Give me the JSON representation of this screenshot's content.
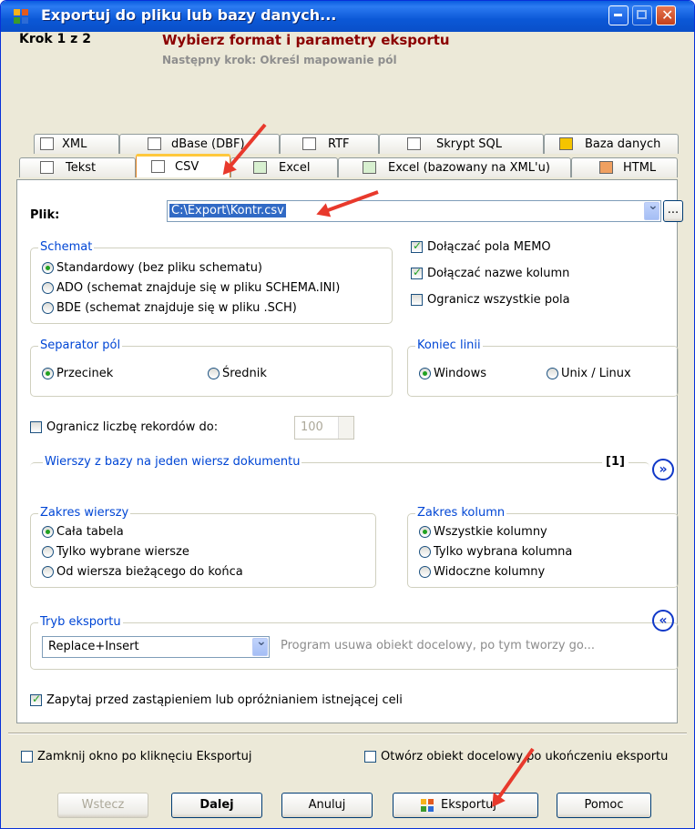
{
  "window": {
    "title": "Exportuj do pliku lub bazy danych..."
  },
  "header": {
    "step": "Krok 1 z 2",
    "title": "Wybierz format i parametry eksportu",
    "next": "Następny krok: Określ mapowanie pól"
  },
  "tabs_row1": [
    {
      "label": "XML",
      "icon": "xml-icon"
    },
    {
      "label": "dBase (DBF)",
      "icon": "dbase-icon"
    },
    {
      "label": "RTF",
      "icon": "rtf-icon"
    },
    {
      "label": "Skrypt SQL",
      "icon": "sql-icon"
    },
    {
      "label": "Baza danych",
      "icon": "database-icon"
    }
  ],
  "tabs_row2": [
    {
      "label": "Tekst",
      "icon": "text-icon"
    },
    {
      "label": "CSV",
      "icon": "csv-icon",
      "active": true
    },
    {
      "label": "Excel",
      "icon": "excel-icon"
    },
    {
      "label": "Excel (bazowany na XML'u)",
      "icon": "excel-xml-icon"
    },
    {
      "label": "HTML",
      "icon": "html-icon"
    }
  ],
  "file": {
    "label": "Plik:",
    "value": "C:\\Export\\Kontr.csv",
    "browse": "..."
  },
  "schema": {
    "legend": "Schemat",
    "options": [
      "Standardowy (bez pliku schematu)",
      "ADO (schemat znajduje się w pliku SCHEMA.INI)",
      "BDE (schemat znajduje się w pliku .SCH)"
    ],
    "selected": 0
  },
  "checks": [
    {
      "label": "Dołączać pola MEMO",
      "checked": true
    },
    {
      "label": "Dołączać nazwe kolumn",
      "checked": true
    },
    {
      "label": "Ogranicz wszystkie pola",
      "checked": false
    }
  ],
  "separator": {
    "legend": "Separator pól",
    "options": [
      "Przecinek",
      "Średnik"
    ],
    "selected": 0
  },
  "line_end": {
    "legend": "Koniec linii",
    "options": [
      "Windows",
      "Unix / Linux"
    ],
    "selected": 0
  },
  "limit": {
    "label": "Ogranicz liczbę rekordów do:",
    "checked": false,
    "value": "100"
  },
  "rows_per_doc": {
    "label": "Wierszy z bazy na jeden wiersz dokumentu",
    "value": "[1]",
    "toggle": "»"
  },
  "row_range": {
    "legend": "Zakres wierszy",
    "options": [
      "Cała tabela",
      "Tylko wybrane wiersze",
      "Od wiersza bieżącego do końca"
    ],
    "selected": 0
  },
  "col_range": {
    "legend": "Zakres kolumn",
    "options": [
      "Wszystkie kolumny",
      "Tylko wybrana kolumna",
      "Widoczne kolumny"
    ],
    "selected": 0
  },
  "export_mode": {
    "legend": "Tryb eksportu",
    "value": "Replace+Insert",
    "description": "Program usuwa obiekt docelowy, po tym tworzy go...",
    "toggle": "«"
  },
  "ask_replace": {
    "label": "Zapytaj przed zastąpieniem lub opróżnianiem istnejącej celi",
    "checked": true
  },
  "footer": {
    "close_after": "Zamknij okno po kliknęciu Eksportuj",
    "open_after": "Otwórz obiekt docelowy po ukończeniu eksportu"
  },
  "buttons": {
    "back": "Wstecz",
    "next": "Dalej",
    "cancel": "Anuluj",
    "export": "Eksportuj",
    "help": "Pomoc"
  },
  "colors": {
    "title_bar": "#0A5CE0",
    "header_title": "#8B0000",
    "legend": "#0046D5",
    "arrow": "#E8392C"
  }
}
